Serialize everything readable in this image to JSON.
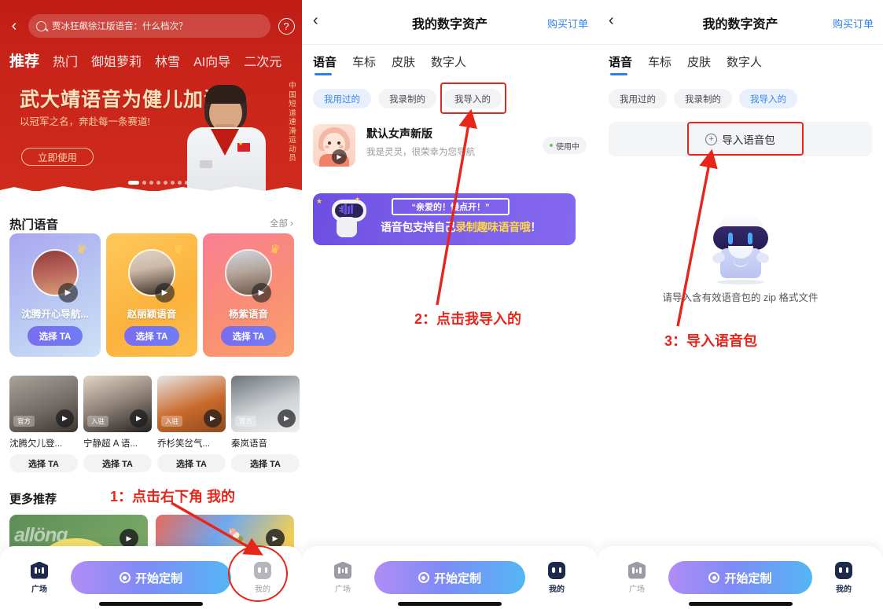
{
  "panel1": {
    "search": {
      "query": "贾冰狂飙徐江版语音：什么档次？",
      "icon": "search-icon"
    },
    "back_icon": "back-chevron-icon",
    "help_icon": "help-question-icon",
    "nav_tabs": [
      {
        "label": "推荐",
        "active": true
      },
      {
        "label": "热门",
        "active": false
      },
      {
        "label": "御姐萝莉",
        "active": false
      },
      {
        "label": "林雪",
        "active": false
      },
      {
        "label": "AI向导",
        "active": false
      },
      {
        "label": "二次元",
        "active": false
      }
    ],
    "hero": {
      "title": "武大靖语音为健儿加油",
      "subtitle": "以冠军之名，奔赴每一条赛道!",
      "cta": "立即使用",
      "side_text": "中国短道速滑运动员",
      "dots_total": 8,
      "dots_active": 1
    },
    "hot_section": {
      "title": "热门语音",
      "all_label": "全部 ›"
    },
    "hot_cards": [
      {
        "name": "沈腾开心导航...",
        "button": "选择 TA"
      },
      {
        "name": "赵丽颖语音",
        "button": "选择 TA"
      },
      {
        "name": "杨紫语音",
        "button": "选择 TA"
      }
    ],
    "grid_items": [
      {
        "name": "沈腾欠儿登...",
        "badge": "官方",
        "button": "选择 TA"
      },
      {
        "name": "宁静超 A 语...",
        "badge": "入驻",
        "button": "选择 TA"
      },
      {
        "name": "乔杉笑岔气...",
        "badge": "入驻",
        "button": "选择 TA"
      },
      {
        "name": "秦岚语音",
        "badge": "官方",
        "button": "选择 TA"
      }
    ],
    "more_section": {
      "title": "更多推荐"
    },
    "bottom_nav": {
      "plaza_label": "广场",
      "cta_label": "开始定制",
      "mine_label": "我的"
    },
    "annotation": "1：点击右下角 我的"
  },
  "panel2": {
    "header": {
      "back_icon": "back-chevron-icon",
      "title": "我的数字资产",
      "right_link": "购买订单"
    },
    "tabs": [
      {
        "label": "语音",
        "active": true
      },
      {
        "label": "车标",
        "active": false
      },
      {
        "label": "皮肤",
        "active": false
      },
      {
        "label": "数字人",
        "active": false
      }
    ],
    "chips": [
      {
        "label": "我用过的",
        "selected": true
      },
      {
        "label": "我录制的",
        "selected": false
      },
      {
        "label": "我导入的",
        "selected": false
      }
    ],
    "voice_item": {
      "name": "默认女声新版",
      "desc": "我是灵灵，很荣幸为您导航",
      "status": "使用中",
      "play_icon": "play-icon"
    },
    "banner": {
      "bubble": "“亲爱的！慢点开！”",
      "line_prefix": "语音包支持自己",
      "line_highlight": "录制趣味语音哦",
      "line_suffix": "！"
    },
    "bottom_nav": {
      "plaza_label": "广场",
      "cta_label": "开始定制",
      "mine_label": "我的"
    },
    "annotation": "2：点击我导入的"
  },
  "panel3": {
    "header": {
      "back_icon": "back-chevron-icon",
      "title": "我的数字资产",
      "right_link": "购买订单"
    },
    "tabs": [
      {
        "label": "语音",
        "active": true
      },
      {
        "label": "车标",
        "active": false
      },
      {
        "label": "皮肤",
        "active": false
      },
      {
        "label": "数字人",
        "active": false
      }
    ],
    "chips": [
      {
        "label": "我用过的",
        "selected": false
      },
      {
        "label": "我录制的",
        "selected": false
      },
      {
        "label": "我导入的",
        "selected": true
      }
    ],
    "import_button": {
      "label": "导入语音包",
      "icon": "plus-circle-icon"
    },
    "empty_hint": "请导入含有效语音包的 zip 格式文件",
    "robot_icon": "robot-mascot-icon",
    "bottom_nav": {
      "plaza_label": "广场",
      "cta_label": "开始定制",
      "mine_label": "我的"
    },
    "annotation": "3：导入语音包"
  },
  "colors": {
    "brand_red": "#c9241a",
    "annotation_red": "#e8251a",
    "link_blue": "#2f7fe8",
    "chip_selected_blue": "#3b86e8",
    "cta_gradient_start": "#b08cf6",
    "cta_gradient_end": "#54b6f4",
    "banner_purple": "#6c4fe0",
    "highlight_yellow": "#ffd84a"
  }
}
